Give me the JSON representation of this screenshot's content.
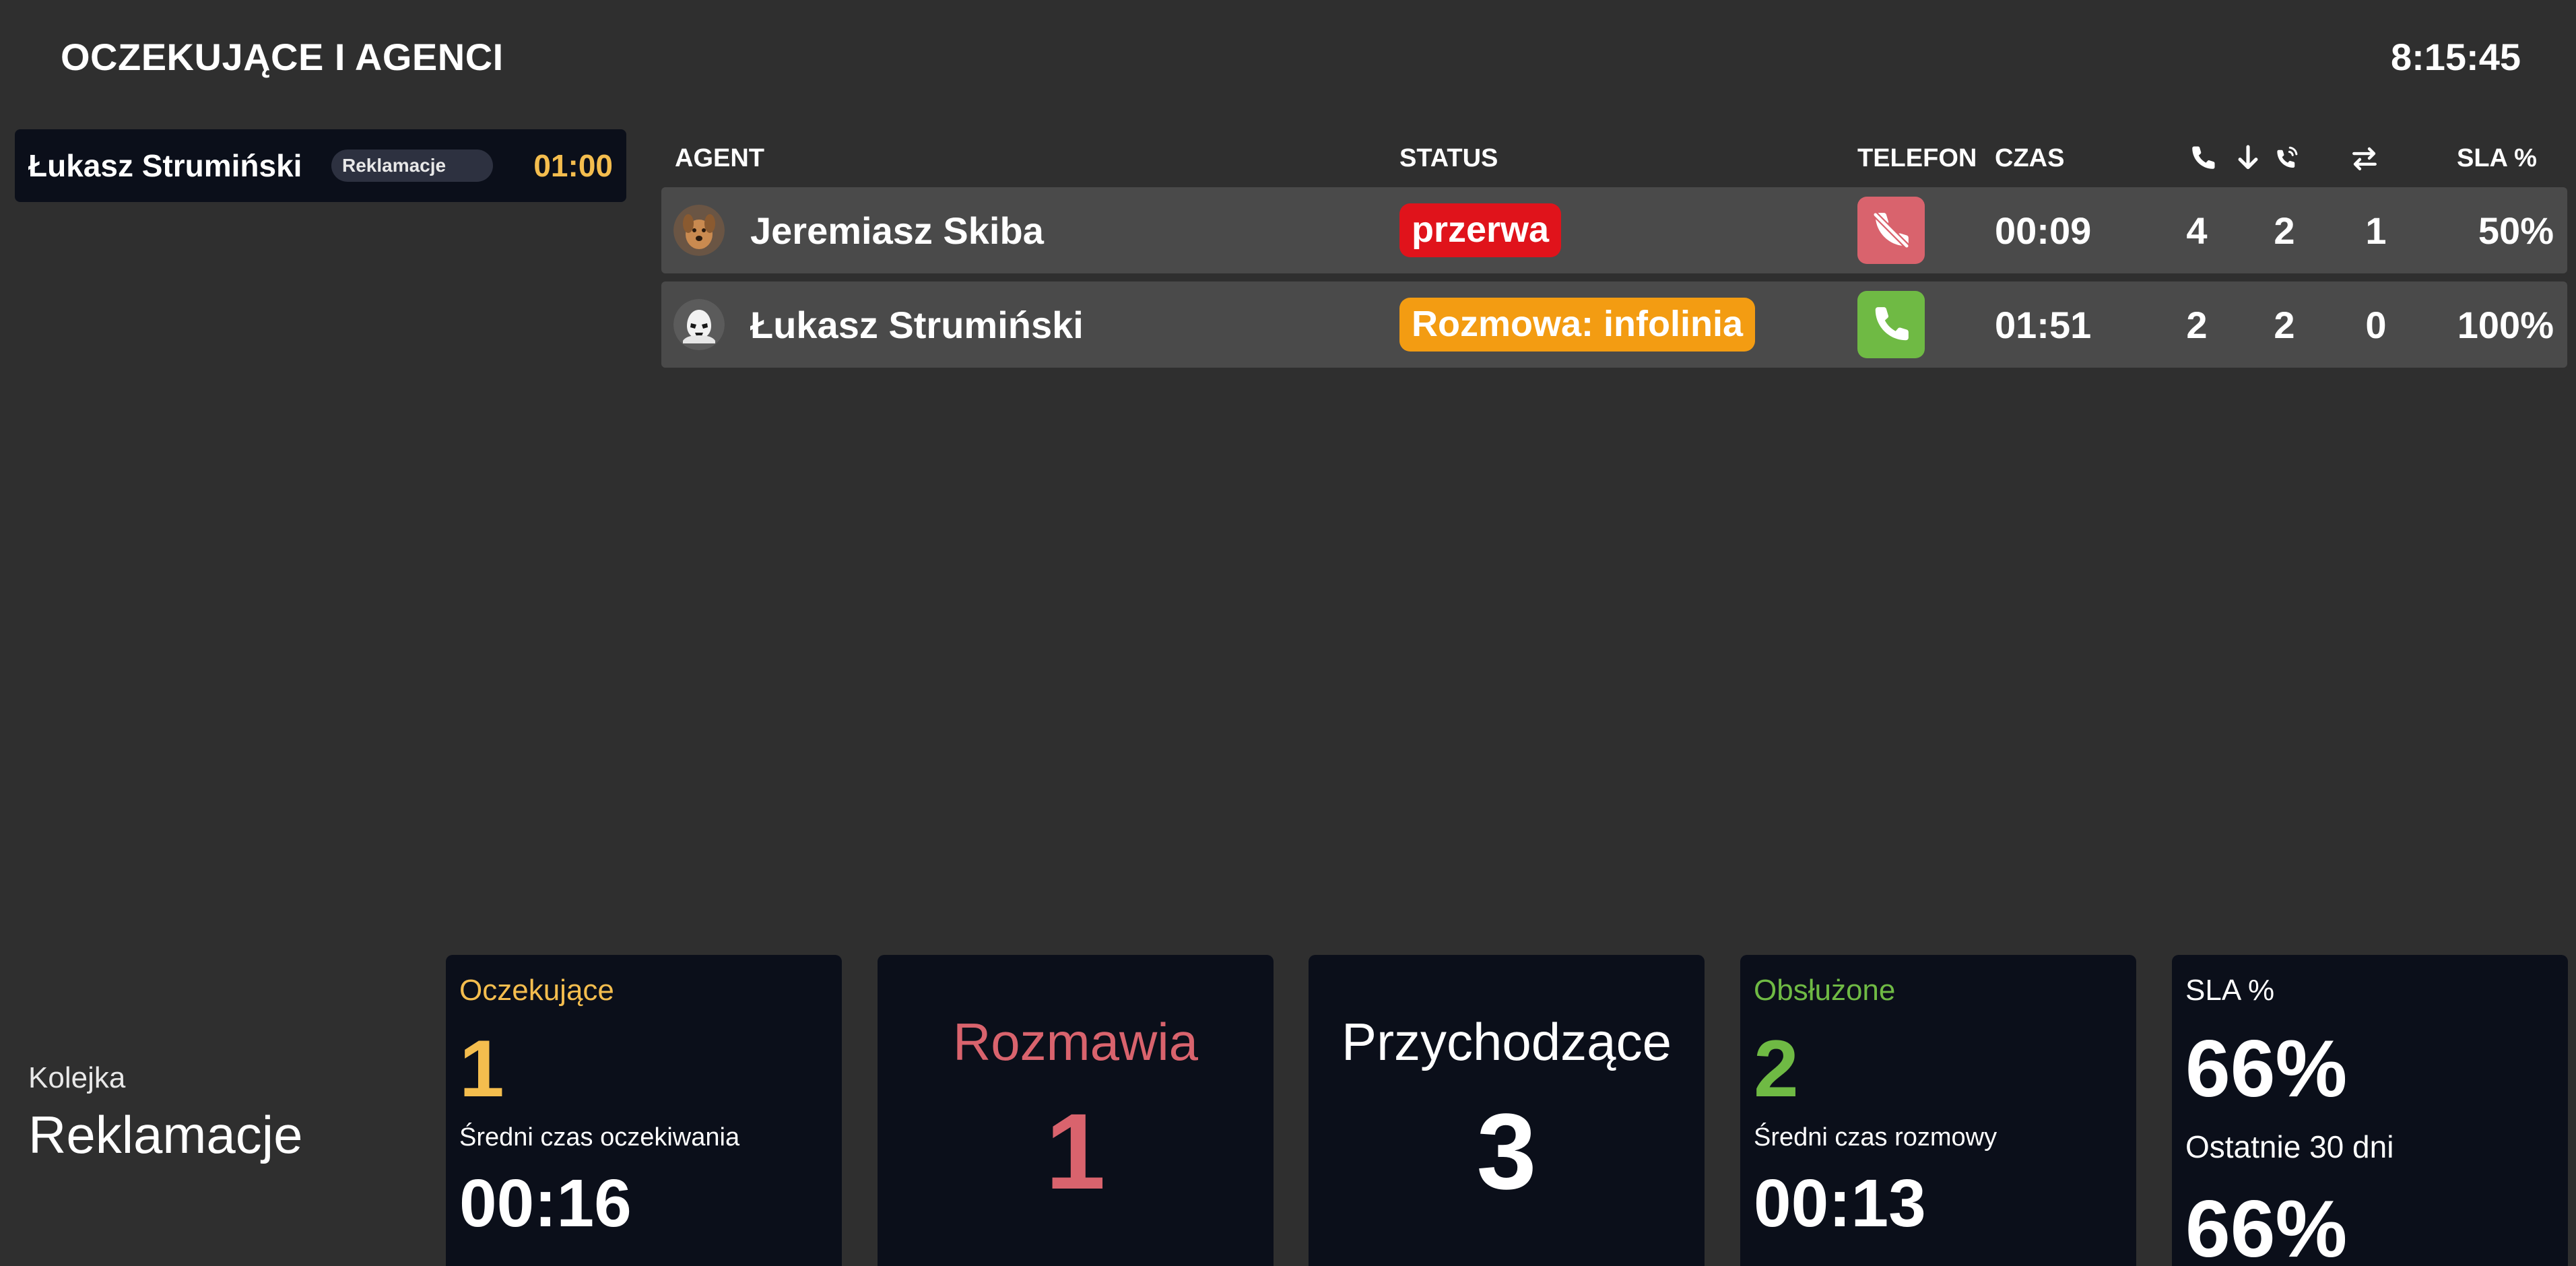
{
  "header": {
    "title": "OCZEKUJĄCE I AGENCI",
    "clock": "8:15:45"
  },
  "waiting": [
    {
      "name": "Łukasz Strumiński",
      "queue": "Reklamacje",
      "time": "01:00"
    }
  ],
  "agents_table": {
    "columns": {
      "agent": "AGENT",
      "status": "STATUS",
      "phone": "TELEFON",
      "time": "CZAS",
      "answered_icon": "incoming-call-icon",
      "missed_icon": "ringing-phone-icon",
      "transfer_icon": "transfer-arrows-icon",
      "sla": "SLA %"
    },
    "rows": [
      {
        "name": "Jeremiasz Skiba",
        "avatar_icon": "dog-avatar-icon",
        "status": "przerwa",
        "status_color": "#e0131b",
        "phone_icon": "phone-off-icon",
        "phone_color": "#d9636d",
        "time": "00:09",
        "answered": "4",
        "missed": "2",
        "transferred": "1",
        "sla": "50%"
      },
      {
        "name": "Łukasz Strumiński",
        "avatar_icon": "stormtrooper-avatar-icon",
        "status": "Rozmowa: infolinia",
        "status_color": "#f39c12",
        "phone_icon": "phone-active-icon",
        "phone_color": "#6fba44",
        "time": "01:51",
        "answered": "2",
        "missed": "2",
        "transferred": "0",
        "sla": "100%"
      }
    ]
  },
  "footer": {
    "queue_label": "Kolejka",
    "queue_name": "Reklamacje",
    "waiting_card": {
      "title": "Oczekujące",
      "value": "1",
      "sub_label": "Średni czas oczekiwania",
      "sub_value": "00:16",
      "color": "#f4bd4e"
    },
    "talking_card": {
      "title": "Rozmawia",
      "value": "1",
      "color": "#d9636d"
    },
    "incoming_card": {
      "title": "Przychodzące",
      "value": "3",
      "color": "#ffffff"
    },
    "served_card": {
      "title": "Obsłużone",
      "value": "2",
      "sub_label": "Średni czas rozmowy",
      "sub_value": "00:13",
      "color": "#6fba44"
    },
    "sla_card": {
      "title": "SLA %",
      "value": "66%",
      "sub_label": "Ostatnie 30 dni",
      "sub_value": "66%"
    }
  }
}
